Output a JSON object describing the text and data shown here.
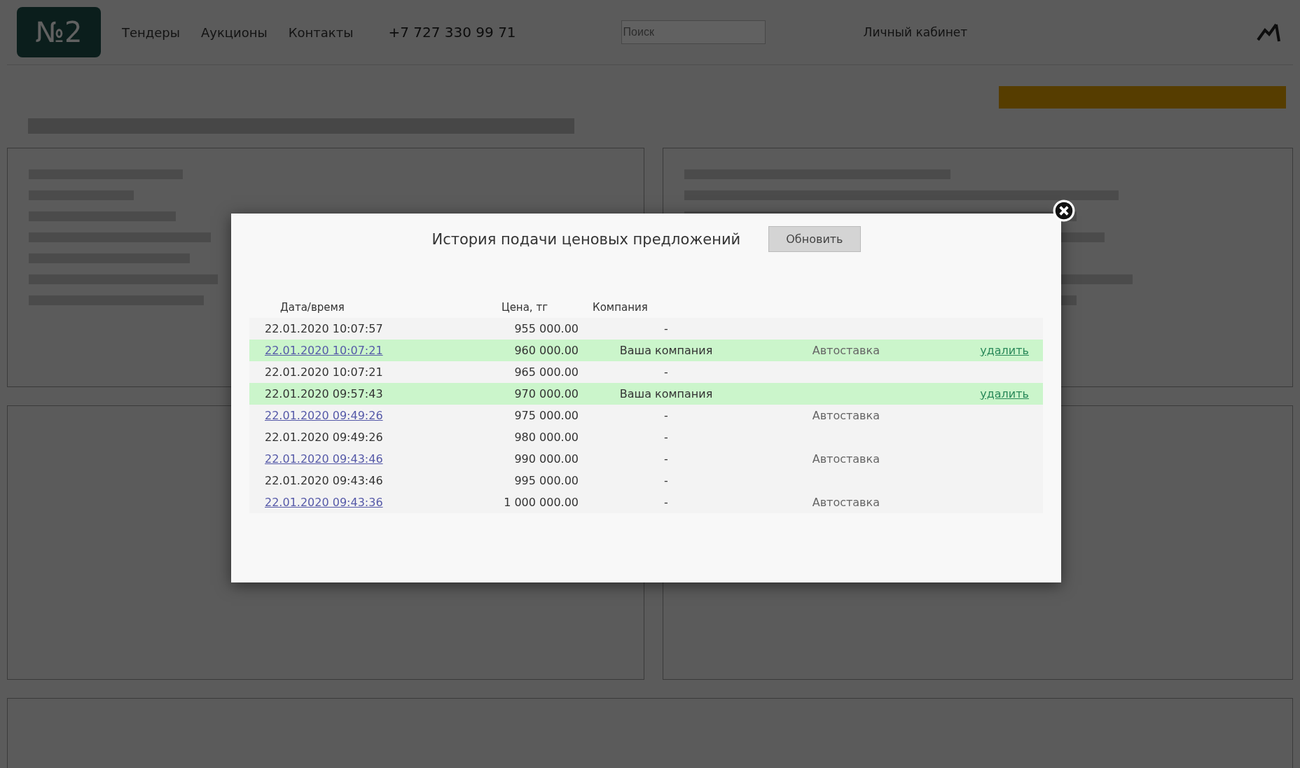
{
  "header": {
    "logo": "№2",
    "nav": [
      "Тендеры",
      "Аукционы",
      "Контакты"
    ],
    "phone": "+7 727 330 99 71",
    "search": {
      "placeholder": "Поиск"
    },
    "account": "Личный кабинет"
  },
  "modal": {
    "title": "История подачи ценовых предложений",
    "refresh_button": "Обновить",
    "table": {
      "columns": [
        "Дата/время",
        "Цена, тг",
        "Компания"
      ],
      "rows": [
        {
          "date": "22.01.2020 10:07:57",
          "link": false,
          "price": "955 000.00",
          "company": "-",
          "mode": "",
          "action": "",
          "own": false
        },
        {
          "date": "22.01.2020 10:07:21",
          "link": true,
          "price": "960 000.00",
          "company": "Ваша компания",
          "mode": "Автоставка",
          "action": "удалить",
          "own": true
        },
        {
          "date": "22.01.2020 10:07:21",
          "link": false,
          "price": "965 000.00",
          "company": "-",
          "mode": "",
          "action": "",
          "own": false
        },
        {
          "date": "22.01.2020 09:57:43",
          "link": false,
          "price": "970 000.00",
          "company": "Ваша компания",
          "mode": "",
          "action": "удалить",
          "own": true
        },
        {
          "date": "22.01.2020 09:49:26",
          "link": true,
          "price": "975 000.00",
          "company": "-",
          "mode": "Автоставка",
          "action": "",
          "own": false
        },
        {
          "date": "22.01.2020 09:49:26",
          "link": false,
          "price": "980 000.00",
          "company": "-",
          "mode": "",
          "action": "",
          "own": false
        },
        {
          "date": "22.01.2020 09:43:46",
          "link": true,
          "price": "990 000.00",
          "company": "-",
          "mode": "Автоставка",
          "action": "",
          "own": false
        },
        {
          "date": "22.01.2020 09:43:46",
          "link": false,
          "price": "995 000.00",
          "company": "-",
          "mode": "",
          "action": "",
          "own": false
        },
        {
          "date": "22.01.2020 09:43:36",
          "link": true,
          "price": "1 000 000.00",
          "company": "-",
          "mode": "Автоставка",
          "action": "",
          "own": false
        }
      ]
    }
  }
}
